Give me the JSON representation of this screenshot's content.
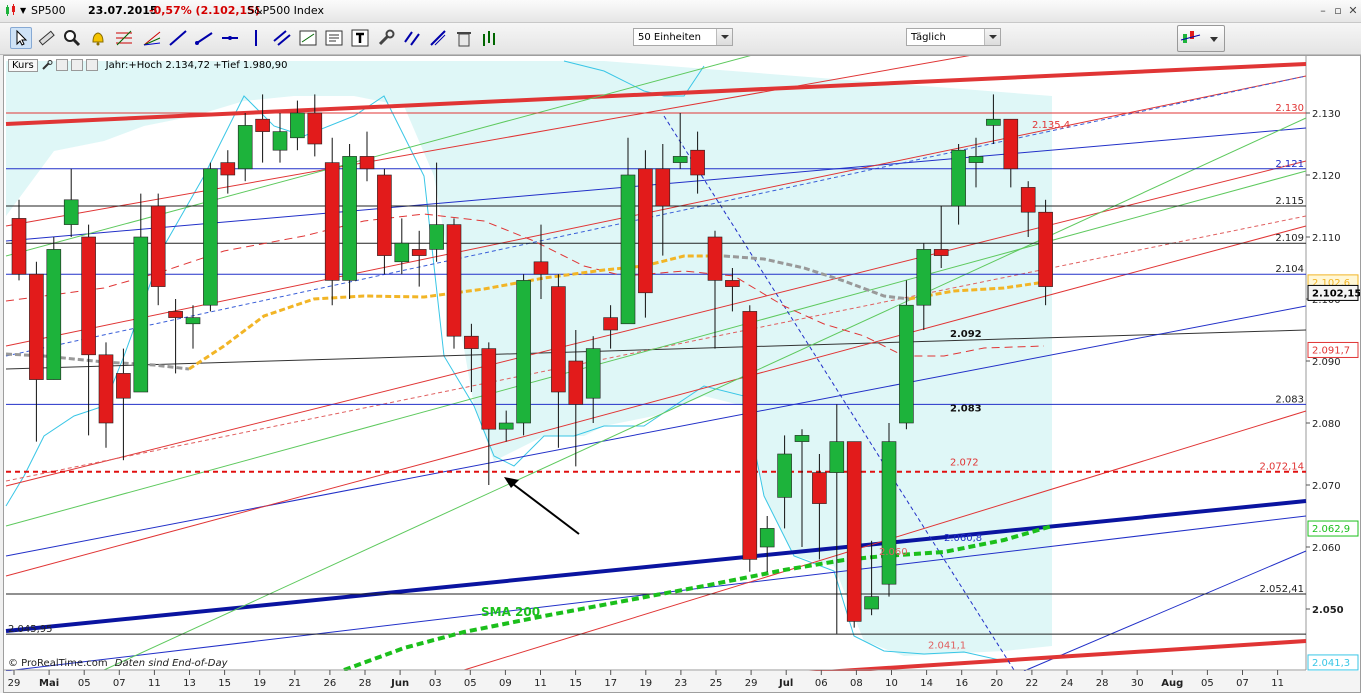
{
  "window": {
    "symbol": "SP500",
    "date": "23.07.2015",
    "change": "-0,57% (2.102,15)",
    "name": "S&P500 Index",
    "minimize": "–",
    "restore": "▫",
    "close": "✕"
  },
  "toolbar": {
    "tools": [
      "cursor-icon",
      "ruler-icon",
      "zoom-icon",
      "alert-bell-icon",
      "fibonacci-icon",
      "fan-icon",
      "trendline-icon",
      "ray-icon",
      "horizontal-line-icon",
      "vertical-line-icon",
      "channel-icon",
      "regression-icon",
      "text-box-icon",
      "text-icon",
      "tool-icon",
      "parallel-icon",
      "pitchfork-icon",
      "delete-icon",
      "bars-icon"
    ],
    "units": "50 Einheiten",
    "period": "Täglich"
  },
  "chart_header": {
    "kurs_label": "Kurs",
    "info": "Jahr:+Hoch 2.134,72 +Tief 1.980,90"
  },
  "footer": {
    "copyright": "© ProRealTime.com",
    "note": "Daten sind End-of-Day"
  },
  "colors": {
    "bullish": "#1db33b",
    "bearish": "#e21b1b",
    "cloud": "#dff7f7",
    "price_tag": "#f4f4f4"
  },
  "chart_data": {
    "type": "candlestick",
    "title": "S&P500 Index",
    "ylim": [
      2040,
      2140
    ],
    "y_ticks": [
      "2.130",
      "2.120",
      "2.110",
      "2.100",
      "2.090",
      "2.080",
      "2.070",
      "2.060",
      "2.050"
    ],
    "x_ticks": [
      "29",
      "Mai",
      "05",
      "07",
      "11",
      "13",
      "15",
      "19",
      "21",
      "26",
      "28",
      "Jun",
      "03",
      "05",
      "09",
      "11",
      "15",
      "17",
      "19",
      "23",
      "25",
      "29",
      "Jul",
      "06",
      "08",
      "10",
      "14",
      "16",
      "20",
      "22",
      "24",
      "28",
      "30",
      "Aug",
      "05",
      "07",
      "11"
    ],
    "levels": [
      {
        "label": "2.130",
        "value": 2130
      },
      {
        "label": "2.121",
        "value": 2121
      },
      {
        "label": "2.115",
        "value": 2115
      },
      {
        "label": "2.109",
        "value": 2109
      },
      {
        "label": "2.104",
        "value": 2104
      },
      {
        "label": "2.092",
        "value": 2092
      },
      {
        "label": "2.083",
        "value": 2083
      },
      {
        "label": "2.083",
        "value": 2083
      },
      {
        "label": "2.072",
        "value": 2072
      },
      {
        "label": "2.072,14",
        "value": 2072.14
      },
      {
        "label": "2.060,8",
        "value": 2060.8
      },
      {
        "label": "2.060",
        "value": 2060
      },
      {
        "label": "2.052,41",
        "value": 2052.41
      },
      {
        "label": "2.045,95",
        "value": 2045.95
      },
      {
        "label": "2.041,1",
        "value": 2041.1
      },
      {
        "label": "2.135,4",
        "value": 2135.4
      }
    ],
    "price_tags": [
      "2.102,6",
      "2.102,15",
      "2.091,7",
      "2.062,9",
      "2.041,3"
    ],
    "annotations": [
      "SMA 200"
    ]
  }
}
